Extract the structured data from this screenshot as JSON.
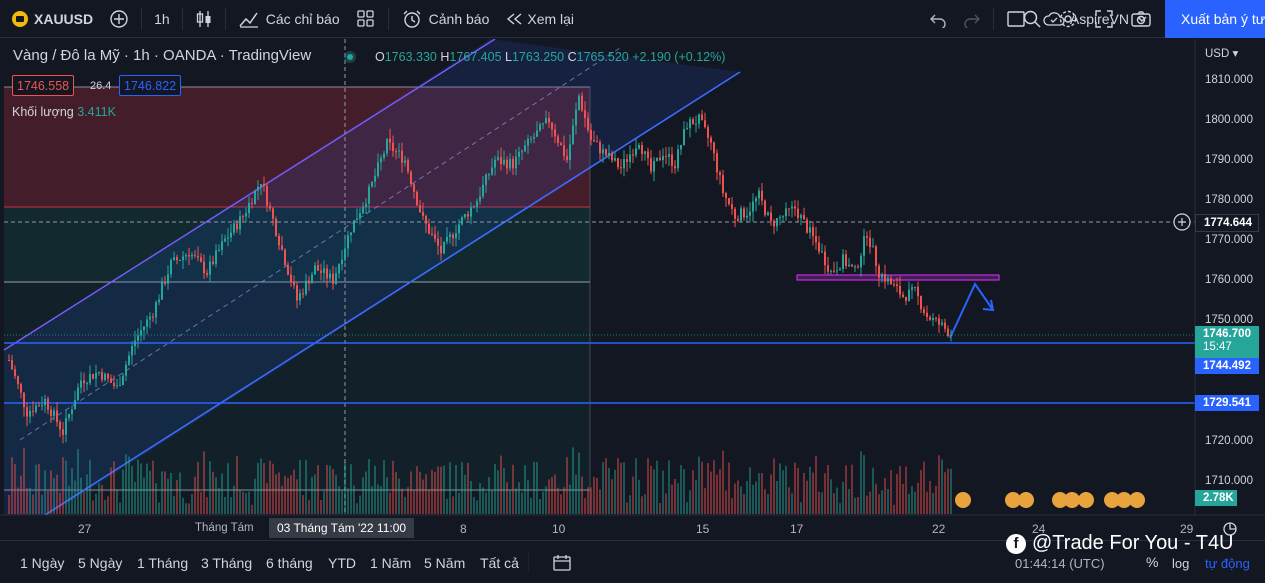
{
  "toolbar": {
    "symbol": "XAUUSD",
    "interval": "1h",
    "indicators_label": "Các chỉ báo",
    "alerts_label": "Cảnh báo",
    "replay_label": "Xem lại",
    "layout_name": "AspireVN",
    "export_label": "Xuất bản ý tư"
  },
  "legend": {
    "title": "Vàng / Đô la Mỹ · 1h · OANDA · TradingView",
    "o_label": "O",
    "o": "1763.330",
    "h_label": "H",
    "h": "1767.405",
    "l_label": "L",
    "l": "1763.250",
    "c_label": "C",
    "c": "1765.520",
    "change": "+2.190 (+0.12%)",
    "bid": "1746.558",
    "spread": "26.4",
    "ask": "1746.822",
    "volume_label": "Khối lượng",
    "volume": "3.411K"
  },
  "price_axis": {
    "currency": "USD",
    "ticks": [
      "1810.000",
      "1800.000",
      "1790.000",
      "1780.000",
      "1770.000",
      "1760.000",
      "1750.000",
      "1720.000",
      "1710.000"
    ],
    "crosshair_price": "1774.644",
    "last_price": "1746.700",
    "countdown": "15:47",
    "line1_price": "1744.492",
    "line2_price": "1729.541",
    "volume_tag": "2.78K"
  },
  "time_axis": {
    "labels": [
      "27",
      "Tháng Tám",
      "8",
      "10",
      "15",
      "17",
      "22",
      "24",
      "29"
    ],
    "crosshair_time": "03 Tháng Tám '22   11:00"
  },
  "ranges": [
    "1 Ngày",
    "5 Ngày",
    "1 Tháng",
    "3 Tháng",
    "6 tháng",
    "YTD",
    "1 Năm",
    "5 Năm",
    "Tất cả"
  ],
  "status": {
    "watermark": "@Trade For You - T4U",
    "clock": "01:44:14 (UTC)",
    "percent": "%",
    "log": "log",
    "auto": "tự động"
  },
  "colors": {
    "up": "#26a69a",
    "down": "#ef5350",
    "channel": "#2962ff",
    "accent": "#2962ff"
  },
  "chart_data": {
    "type": "candlestick",
    "symbol": "XAUUSD",
    "timeframe": "1h",
    "ylim": [
      1702,
      1814
    ],
    "horizontal_levels": [
      1744.492,
      1729.541
    ],
    "zone_levels": [
      1809,
      1778,
      1775,
      1759.5
    ],
    "resistance_zone": [
      1760,
      1761
    ],
    "path": [
      [
        0,
        1740
      ],
      [
        6,
        1727
      ],
      [
        12,
        1730
      ],
      [
        18,
        1722
      ],
      [
        24,
        1735
      ],
      [
        30,
        1737
      ],
      [
        36,
        1733
      ],
      [
        42,
        1745
      ],
      [
        48,
        1752
      ],
      [
        54,
        1764
      ],
      [
        60,
        1767
      ],
      [
        66,
        1762
      ],
      [
        72,
        1770
      ],
      [
        78,
        1776
      ],
      [
        84,
        1785
      ],
      [
        90,
        1770
      ],
      [
        96,
        1755
      ],
      [
        102,
        1763
      ],
      [
        108,
        1760
      ],
      [
        114,
        1773
      ],
      [
        120,
        1782
      ],
      [
        126,
        1794
      ],
      [
        132,
        1790
      ],
      [
        138,
        1775
      ],
      [
        144,
        1767
      ],
      [
        150,
        1774
      ],
      [
        156,
        1780
      ],
      [
        162,
        1790
      ],
      [
        168,
        1789
      ],
      [
        174,
        1795
      ],
      [
        180,
        1800
      ],
      [
        186,
        1790
      ],
      [
        190,
        1806
      ],
      [
        194,
        1795
      ],
      [
        198,
        1792
      ],
      [
        204,
        1788
      ],
      [
        210,
        1795
      ],
      [
        214,
        1787
      ],
      [
        218,
        1792
      ],
      [
        222,
        1789
      ],
      [
        226,
        1799
      ],
      [
        230,
        1800
      ],
      [
        234,
        1794
      ],
      [
        238,
        1782
      ],
      [
        242,
        1776
      ],
      [
        246,
        1777
      ],
      [
        250,
        1781
      ],
      [
        254,
        1774
      ],
      [
        258,
        1776
      ],
      [
        262,
        1778
      ],
      [
        266,
        1773
      ],
      [
        270,
        1768
      ],
      [
        274,
        1762
      ],
      [
        278,
        1765
      ],
      [
        282,
        1762
      ],
      [
        286,
        1772
      ],
      [
        290,
        1762
      ],
      [
        294,
        1759
      ],
      [
        298,
        1756
      ],
      [
        302,
        1757
      ],
      [
        306,
        1751
      ],
      [
        310,
        1749
      ],
      [
        314,
        1746.7
      ]
    ]
  }
}
